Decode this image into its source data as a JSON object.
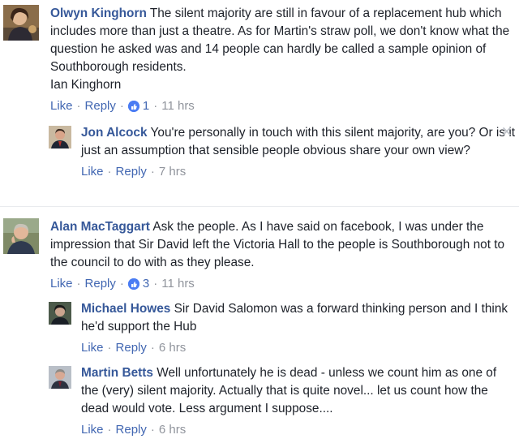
{
  "thread1": {
    "top": {
      "author": "Olwyn Kinghorn",
      "text": "The silent majority are still in favour of a replacement hub which includes more than just a theatre. As for Martin's straw poll, we don't know what the question he asked was and 14 people can hardly be called a sample opinion of Southborough residents.",
      "signature": "Ian Kinghorn",
      "like_label": "Like",
      "reply_label": "Reply",
      "reaction_count": "1",
      "time": "11 hrs"
    },
    "reply": {
      "author": "Jon Alcock",
      "text": "You're personally in touch with this silent majority, are you? Or is it just an assumption that sensible people obvious share your own view?",
      "like_label": "Like",
      "reply_label": "Reply",
      "time": "7 hrs",
      "close_glyph": "✕"
    }
  },
  "thread2": {
    "top": {
      "author": "Alan MacTaggart",
      "text": "Ask the people. As I have said on facebook, I was under the impression that Sir David left the Victoria Hall to the people is Southborough not to the council to do with as they please.",
      "like_label": "Like",
      "reply_label": "Reply",
      "reaction_count": "3",
      "time": "11 hrs"
    },
    "replies": [
      {
        "author": "Michael Howes",
        "text": "Sir David Salomon was a forward thinking person and I think he'd support the Hub",
        "like_label": "Like",
        "reply_label": "Reply",
        "time": "6 hrs"
      },
      {
        "author": "Martin Betts",
        "text": "Well unfortunately he is dead - unless we count him as one of the (very) silent majority. Actually that is quite novel... let us count how the dead would vote. Less argument I suppose....",
        "like_label": "Like",
        "reply_label": "Reply",
        "time": "6 hrs"
      }
    ]
  },
  "separator": "·",
  "colors": {
    "name": "#365899",
    "link": "#4267b2",
    "meta": "#90949c",
    "text": "#1d2129",
    "like_badge": "#4a7cf3"
  }
}
